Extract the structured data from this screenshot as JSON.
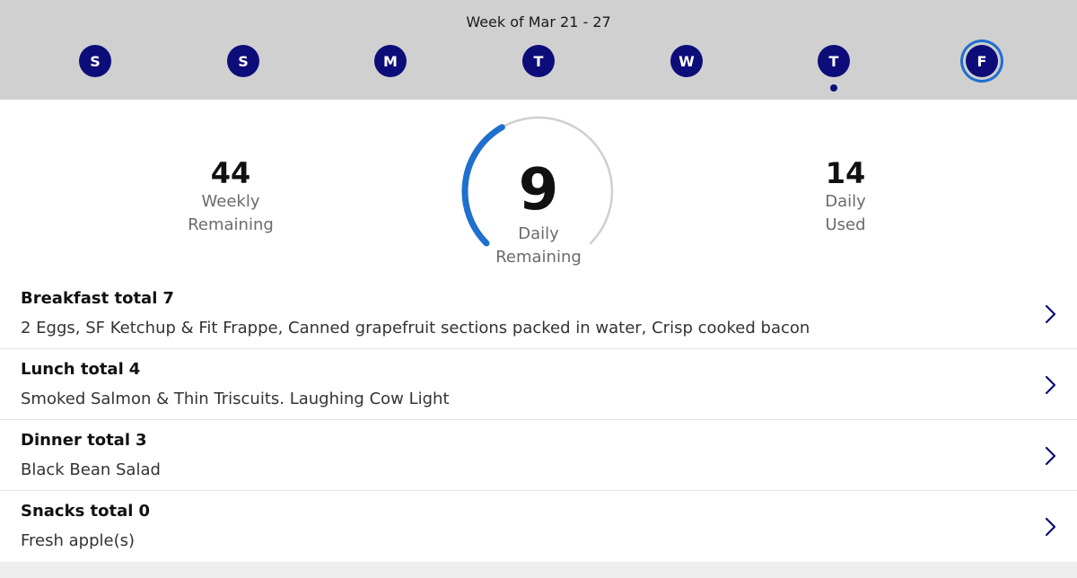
{
  "header": {
    "week_label": "Week of Mar 21 - 27",
    "days": [
      {
        "letter": "S",
        "selected": false,
        "has_dot": false
      },
      {
        "letter": "S",
        "selected": false,
        "has_dot": false
      },
      {
        "letter": "M",
        "selected": false,
        "has_dot": false
      },
      {
        "letter": "T",
        "selected": false,
        "has_dot": false
      },
      {
        "letter": "W",
        "selected": false,
        "has_dot": false
      },
      {
        "letter": "T",
        "selected": false,
        "has_dot": true
      },
      {
        "letter": "F",
        "selected": true,
        "has_dot": false
      }
    ]
  },
  "summary": {
    "weekly": {
      "value": "44",
      "label_line1": "Weekly",
      "label_line2": "Remaining"
    },
    "daily_remaining": {
      "value": "9",
      "label_line1": "Daily",
      "label_line2": "Remaining",
      "progress_fraction": 0.39
    },
    "daily_used": {
      "value": "14",
      "label_line1": "Daily",
      "label_line2": "Used"
    }
  },
  "meals": [
    {
      "name": "Breakfast total",
      "total": "7",
      "items": "2 Eggs, SF Ketchup & Fit Frappe, Canned grapefruit sections packed in water, Crisp cooked bacon"
    },
    {
      "name": "Lunch total",
      "total": "4",
      "items": "Smoked Salmon & Thin Triscuits. Laughing Cow Light"
    },
    {
      "name": "Dinner total",
      "total": "3",
      "items": "Black Bean Salad"
    },
    {
      "name": "Snacks total",
      "total": "0",
      "items": "Fresh apple(s)"
    }
  ],
  "colors": {
    "header_bg": "#d0d0d0",
    "day_circle": "#0d0d7a",
    "selected_ring": "#1f6fcf",
    "gauge_progress": "#1f6fcf",
    "gauge_track": "#cfcfcf",
    "chevron": "#0d0d7a"
  },
  "icons": {
    "row_chevron": "chevron-right-icon"
  }
}
